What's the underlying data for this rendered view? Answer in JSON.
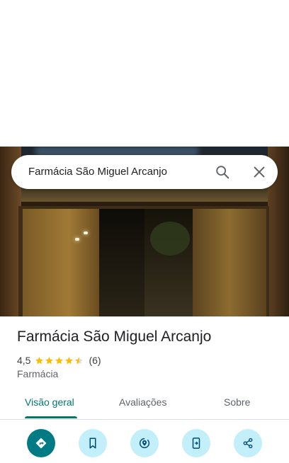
{
  "search": {
    "query": "Farmácia São Miguel Arcanjo"
  },
  "place": {
    "name": "Farmácia São Miguel Arcanjo",
    "rating": "4,5",
    "rating_value": 4.5,
    "review_count": "(6)",
    "category": "Farmácia"
  },
  "tabs": [
    {
      "label": "Visão geral"
    },
    {
      "label": "Avaliações"
    },
    {
      "label": "Sobre"
    }
  ],
  "active_tab": "Visão geral",
  "actions": [
    {
      "icon": "directions-icon"
    },
    {
      "icon": "bookmark-icon"
    },
    {
      "icon": "nearby-icon"
    },
    {
      "icon": "send-to-phone-icon"
    },
    {
      "icon": "share-icon"
    }
  ],
  "colors": {
    "accent": "#00796b",
    "primary_action": "#007b83",
    "action_bg": "#c2effa",
    "star": "#fbbc04"
  }
}
